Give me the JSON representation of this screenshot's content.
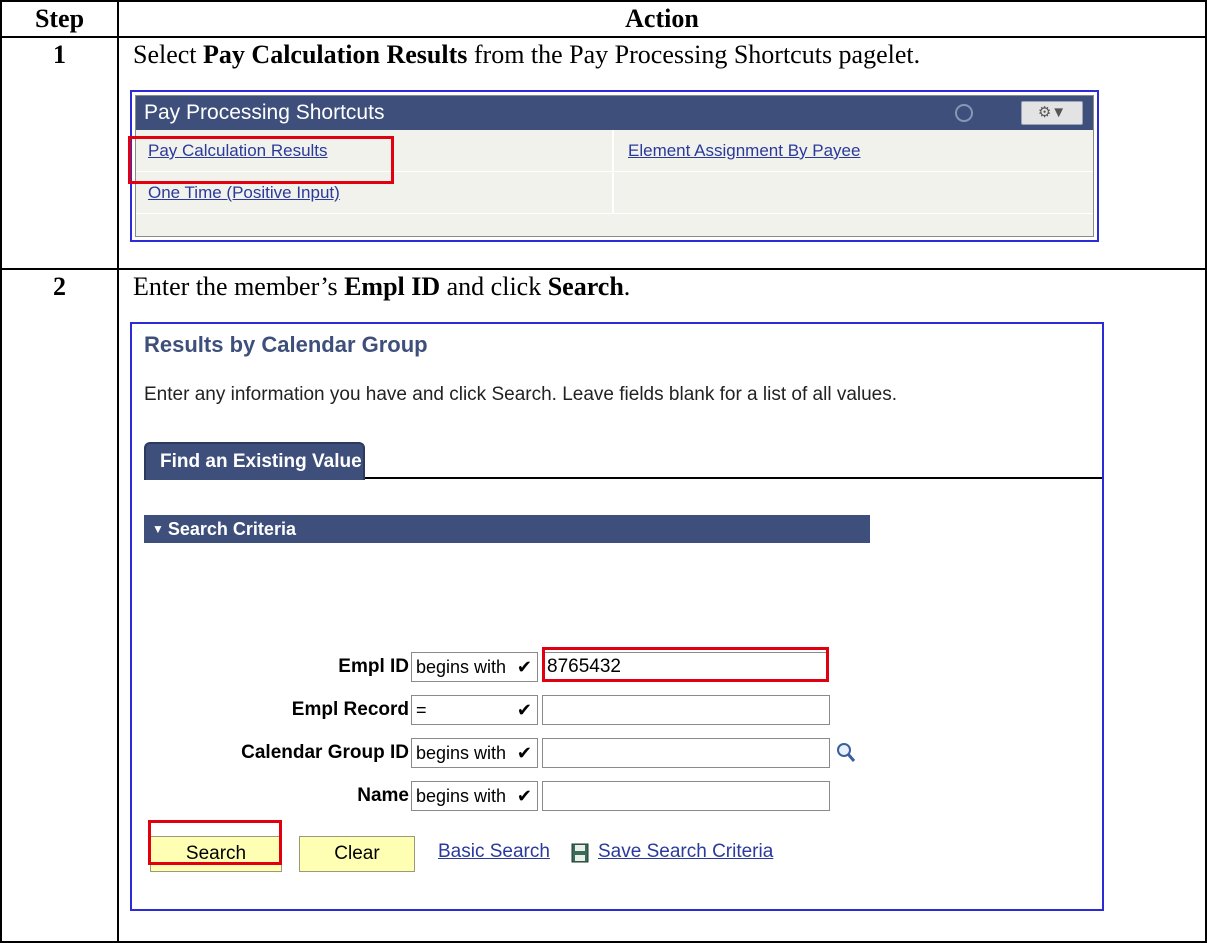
{
  "table": {
    "col_step": "Step",
    "col_action": "Action"
  },
  "steps": [
    {
      "num": "1",
      "pre": "Select ",
      "bold": "Pay Calculation Results",
      "post": " from the Pay Processing Shortcuts pagelet."
    },
    {
      "num": "2",
      "pre": "Enter the member’s ",
      "bold": "Empl ID",
      "mid": " and click ",
      "bold2": "Search",
      "post": "."
    }
  ],
  "pagelet": {
    "title": "Pay Processing Shortcuts",
    "links": {
      "pay_calc": "Pay Calculation Results",
      "element_assign": "Element Assignment By Payee",
      "one_time": "One Time (Positive Input)"
    }
  },
  "search_page": {
    "title": "Results by Calendar Group",
    "instructions": "Enter any information you have and click Search. Leave fields blank for a list of all values.",
    "tab": "Find an Existing Value",
    "section": "Search Criteria",
    "fields": {
      "empl_id": {
        "label": "Empl ID",
        "operator": "begins with",
        "value": "8765432"
      },
      "empl_record": {
        "label": "Empl Record",
        "operator": "=",
        "value": ""
      },
      "cal_group": {
        "label": "Calendar Group ID",
        "operator": "begins with",
        "value": ""
      },
      "name": {
        "label": "Name",
        "operator": "begins with",
        "value": ""
      }
    },
    "buttons": {
      "search": "Search",
      "clear": "Clear"
    },
    "links": {
      "basic_search": "Basic Search",
      "save_criteria": "Save Search Criteria"
    }
  },
  "colors": {
    "header_blue": "#3e4f7c",
    "highlight_red": "#e00010",
    "button_yellow": "#ffffb4",
    "link_blue": "#2a3a9c"
  },
  "icons": [
    "refresh-icon",
    "gear-icon",
    "chevron-down-icon",
    "lookup-magnifier-icon",
    "save-icon"
  ]
}
